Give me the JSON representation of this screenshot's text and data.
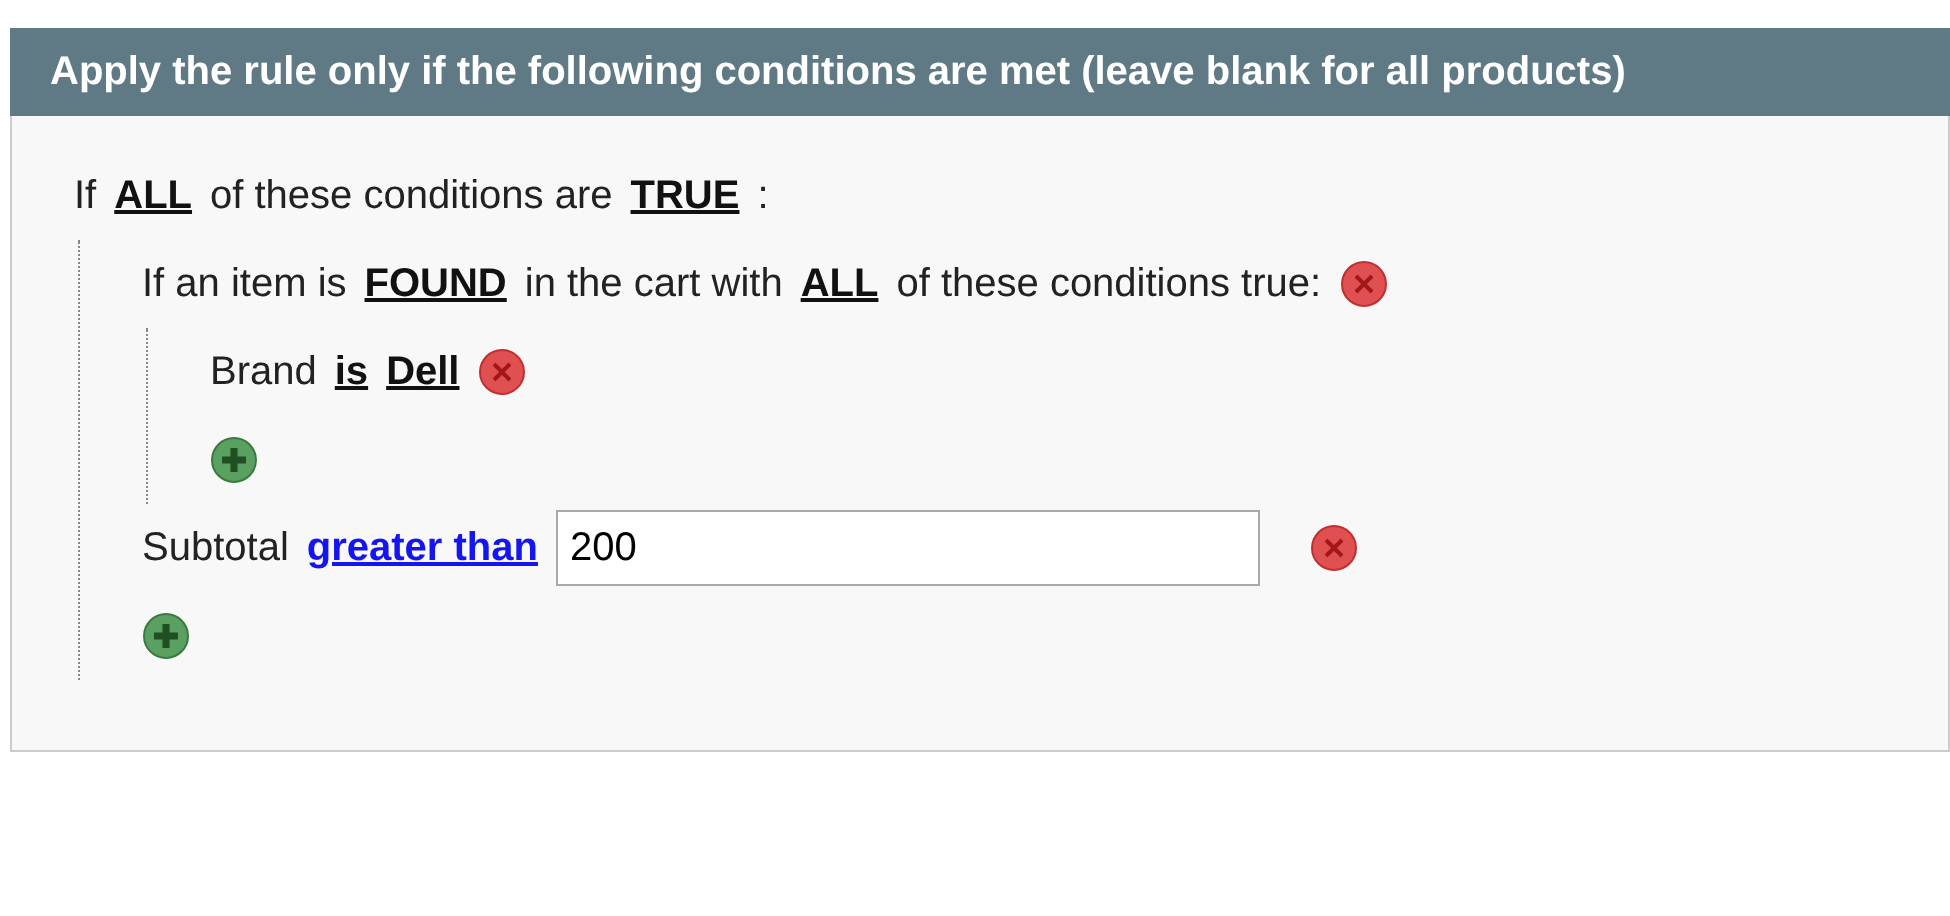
{
  "header": {
    "title": "Apply the rule only if the following conditions are met (leave blank for all products)"
  },
  "root": {
    "parts": [
      {
        "kind": "text",
        "text": "If"
      },
      {
        "kind": "option",
        "text": "ALL"
      },
      {
        "kind": "text",
        "text": "of these conditions are"
      },
      {
        "kind": "option",
        "text": "TRUE"
      },
      {
        "kind": "text",
        "text": ":"
      }
    ],
    "children": [
      {
        "removable": true,
        "parts": [
          {
            "kind": "text",
            "text": "If an item is"
          },
          {
            "kind": "option",
            "text": "FOUND"
          },
          {
            "kind": "text",
            "text": "in the cart with"
          },
          {
            "kind": "option",
            "text": "ALL"
          },
          {
            "kind": "text",
            "text": "of these conditions true:"
          }
        ],
        "children": [
          {
            "removable": true,
            "parts": [
              {
                "kind": "text",
                "text": "Brand"
              },
              {
                "kind": "option",
                "text": "is"
              },
              {
                "kind": "option",
                "text": "Dell"
              }
            ]
          }
        ]
      },
      {
        "removable": true,
        "parts": [
          {
            "kind": "text",
            "text": "Subtotal"
          },
          {
            "kind": "active",
            "text": "greater than"
          },
          {
            "kind": "input",
            "value": "200"
          }
        ]
      }
    ]
  }
}
